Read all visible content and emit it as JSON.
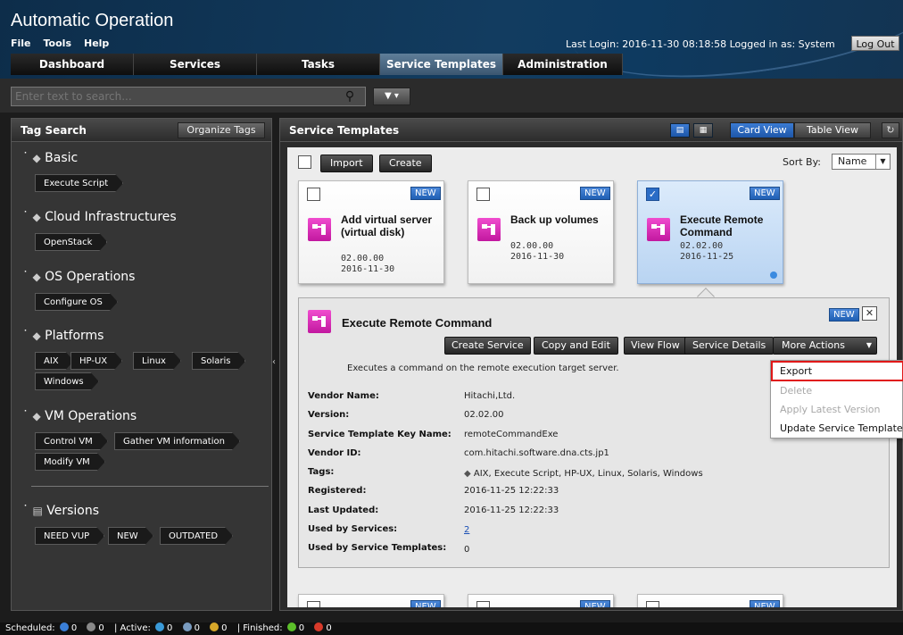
{
  "header": {
    "app_title": "Automatic Operation",
    "menu": [
      "File",
      "Tools",
      "Help"
    ],
    "login_info": "Last Login: 2016-11-30 08:18:58  Logged in as: System",
    "logout_label": "Log Out"
  },
  "tabs": [
    {
      "label": "Dashboard",
      "active": false
    },
    {
      "label": "Services",
      "active": false
    },
    {
      "label": "Tasks",
      "active": false
    },
    {
      "label": "Service Templates",
      "active": true
    },
    {
      "label": "Administration",
      "active": false
    }
  ],
  "search": {
    "placeholder": "Enter text to search..."
  },
  "tag_search": {
    "title": "Tag Search",
    "organize_label": "Organize Tags",
    "groups": [
      {
        "name": "Basic",
        "tags": [
          "Execute Script"
        ]
      },
      {
        "name": "Cloud Infrastructures",
        "tags": [
          "OpenStack"
        ]
      },
      {
        "name": "OS Operations",
        "tags": [
          "Configure OS"
        ]
      },
      {
        "name": "Platforms",
        "tags": [
          "AIX",
          "HP-UX",
          "Linux",
          "Solaris",
          "Windows"
        ]
      },
      {
        "name": "VM Operations",
        "tags": [
          "Control VM",
          "Gather VM information",
          "Modify VM"
        ]
      },
      {
        "name": "Versions",
        "tags": [
          "NEED VUP",
          "NEW",
          "OUTDATED"
        ]
      }
    ]
  },
  "service_templates": {
    "title": "Service Templates",
    "card_view_label": "Card View",
    "table_view_label": "Table View",
    "import_label": "Import",
    "create_label": "Create",
    "sort_by_label": "Sort By:",
    "sort_value": "Name",
    "cards": [
      {
        "badge": "NEW",
        "title": "Add virtual server (virtual disk)",
        "version": "02.00.00",
        "date": "2016-11-30",
        "selected": false
      },
      {
        "badge": "NEW",
        "title": "Back up volumes",
        "version": "02.00.00",
        "date": "2016-11-30",
        "selected": false
      },
      {
        "badge": "NEW",
        "title": "Execute Remote Command",
        "version": "02.02.00",
        "date": "2016-11-25",
        "selected": true
      }
    ],
    "bottom_badges": [
      "NEW",
      "NEW",
      "NEW"
    ]
  },
  "detail": {
    "badge": "NEW",
    "title": "Execute Remote Command",
    "actions": [
      "Create Service",
      "Copy and Edit",
      "View Flow",
      "Service Details",
      "More Actions"
    ],
    "description": "Executes a command on the remote execution target server.",
    "props": [
      {
        "label": "Vendor Name:",
        "value": "Hitachi,Ltd."
      },
      {
        "label": "Version:",
        "value": "02.02.00"
      },
      {
        "label": "Service Template Key Name:",
        "value": "remoteCommandExe"
      },
      {
        "label": "Vendor ID:",
        "value": "com.hitachi.software.dna.cts.jp1"
      },
      {
        "label": "Tags:",
        "value": "AIX, Execute Script, HP-UX, Linux, Solaris, Windows"
      },
      {
        "label": "Registered:",
        "value": "2016-11-25 12:22:33"
      },
      {
        "label": "Last Updated:",
        "value": "2016-11-25 12:22:33"
      },
      {
        "label": "Used by Services:",
        "value": "2"
      },
      {
        "label": "Used by Service Templates:",
        "value": "0"
      }
    ]
  },
  "more_actions_menu": [
    {
      "label": "Export",
      "enabled": true
    },
    {
      "label": "Delete",
      "enabled": false
    },
    {
      "label": "Apply Latest Version",
      "enabled": false
    },
    {
      "label": "Update Service Template",
      "enabled": true
    }
  ],
  "statusbar": {
    "scheduled_label": "Scheduled:",
    "scheduled_count": "0",
    "paused_count": "0",
    "active_label": "| Active:",
    "active_running": "0",
    "active_waiting": "0",
    "active_warning": "0",
    "finished_label": "| Finished:",
    "finished_ok": "0",
    "finished_error": "0"
  },
  "colors": {
    "accent": "#1d56a8",
    "highlight": "#e01818",
    "icon_magenta": "#d61eb4"
  }
}
